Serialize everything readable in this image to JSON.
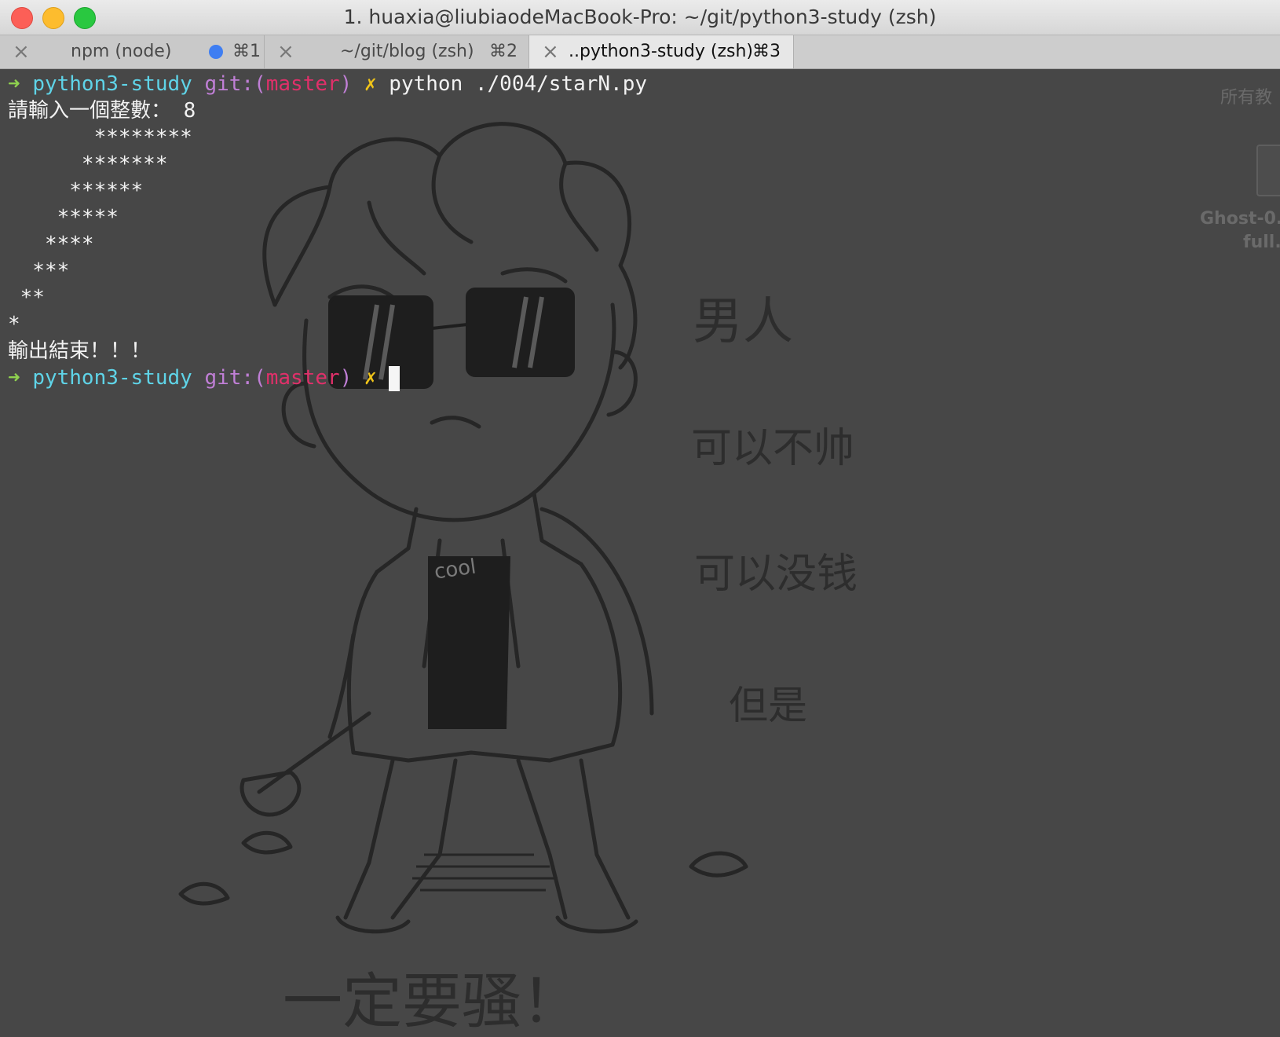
{
  "window": {
    "title": "1. huaxia@liubiaodeMacBook-Pro: ~/git/python3-study (zsh)"
  },
  "tabs": [
    {
      "label": "npm (node)",
      "shortcut": "⌘1",
      "active": false,
      "activity_dot": true
    },
    {
      "label": "~/git/blog (zsh)",
      "shortcut": "⌘2",
      "active": false,
      "activity_dot": false
    },
    {
      "label": "..python3-study (zsh)",
      "shortcut": "⌘3",
      "active": true,
      "activity_dot": false
    }
  ],
  "prompt": {
    "arrow": "➜",
    "dir": "python3-study",
    "git_prefix": "git:(",
    "branch": "master",
    "git_suffix": ")",
    "dirty_mark": "✗"
  },
  "terminal": {
    "command": "python ./004/starN.py",
    "input_prompt": "請輸入一個整數：",
    "input_value": "8",
    "star_lines": [
      "       ********",
      "      *******",
      "     ******",
      "    *****",
      "   ****",
      "  ***",
      " **",
      "*"
    ],
    "end_message": "輸出結束！！！"
  },
  "desktop_peek": {
    "label_1": "所有教",
    "label_2": "Ghost-0.",
    "label_3": "full."
  },
  "wallpaper_text": {
    "line_1": "男人",
    "line_2": "可以不帅",
    "line_3": "可以没钱",
    "line_4": "但是",
    "line_5": "一定要骚！",
    "shirt": "cool"
  },
  "colors": {
    "prompt_arrow": "#8fd14f",
    "dir": "#5fd4e8",
    "git": "#c07fd6",
    "branch": "#e0306a",
    "dirty": "#f0c419",
    "background": "#474747"
  }
}
